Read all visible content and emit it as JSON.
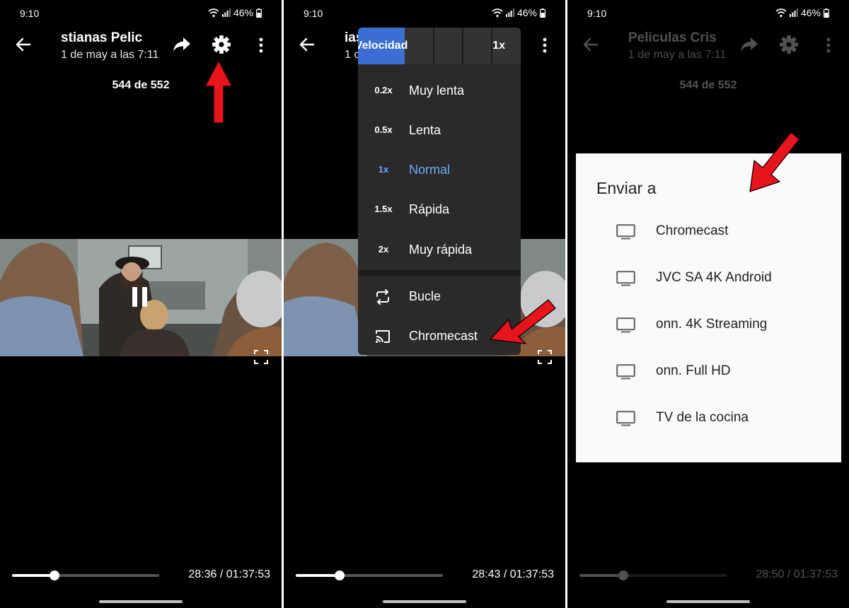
{
  "status_bar": {
    "time": "9:10",
    "battery": "46%"
  },
  "panel1": {
    "title": "stianas   Pelic",
    "subtitle": "1 de may a las 7:11",
    "counter": "544 de 552",
    "time": "28:36 / 01:37:53",
    "progress": 0.29
  },
  "panel2": {
    "title": "ias",
    "subtitle": "1 c",
    "speed_label": "Velocidad",
    "speed_value": "1x",
    "speed_options": [
      {
        "rate": "0.2x",
        "label": "Muy lenta"
      },
      {
        "rate": "0.5x",
        "label": "Lenta"
      },
      {
        "rate": "1x",
        "label": "Normal"
      },
      {
        "rate": "1.5x",
        "label": "Rápida"
      },
      {
        "rate": "2x",
        "label": "Muy rápida"
      }
    ],
    "selected_speed": "Normal",
    "loop_label": "Bucle",
    "cast_label": "Chromecast",
    "time": "28:43 / 01:37:53",
    "progress": 0.3
  },
  "panel3": {
    "title": "Peliculas Cris",
    "subtitle": "1 de may a las 7:11",
    "counter": "544 de 552",
    "time": "28:50 / 01:37:53",
    "progress": 0.3,
    "dialog_title": "Enviar a",
    "devices": [
      "Chromecast",
      "JVC SA 4K Android",
      "onn. 4K Streaming",
      "onn. Full HD",
      "TV de la cocina"
    ]
  },
  "colors": {
    "accent": "#3c6fd4",
    "selected_text": "#6ea8f7",
    "annotation_arrow": "#e8141b",
    "menu_bg": "#2a2a2a"
  },
  "icons": [
    "back-arrow-icon",
    "share-icon",
    "gear-icon",
    "more-vertical-icon",
    "pause-icon",
    "fullscreen-icon",
    "loop-icon",
    "cast-icon",
    "tv-icon",
    "wifi-icon",
    "signal-icon",
    "battery-icon"
  ]
}
